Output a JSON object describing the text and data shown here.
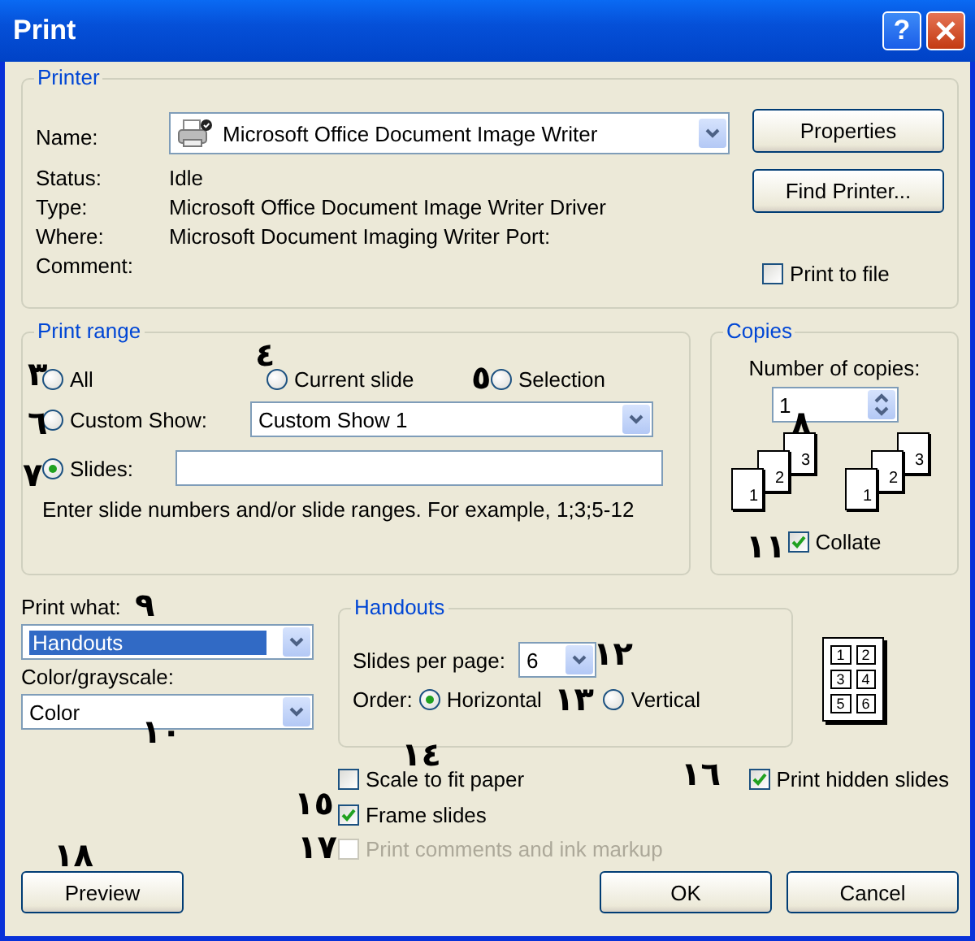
{
  "window": {
    "title": "Print",
    "help": "?"
  },
  "printer": {
    "title": "Printer",
    "name_label": "Name:",
    "name_value": "Microsoft Office Document Image Writer",
    "details": [
      {
        "label": "Status:",
        "value": "Idle"
      },
      {
        "label": "Type:",
        "value": "Microsoft Office Document Image Writer Driver"
      },
      {
        "label": "Where:",
        "value": "Microsoft Document Imaging Writer Port:"
      },
      {
        "label": "Comment:"
      }
    ],
    "properties_button": "Properties",
    "find_printer_button": "Find Printer...",
    "print_to_file": {
      "label": "Print to file",
      "checked": false
    }
  },
  "print_range": {
    "title": "Print range",
    "options": [
      {
        "label": "All",
        "selected": false
      },
      {
        "label": "Current slide",
        "selected": false
      },
      {
        "label": "Selection",
        "selected": false
      },
      {
        "label": "Custom Show:",
        "selected": false
      },
      {
        "label": "Slides:",
        "selected": true
      }
    ],
    "custom_show_value": "Custom Show 1",
    "hint": "Enter slide numbers and/or slide ranges. For example, 1;3;5-12"
  },
  "copies": {
    "title": "Copies",
    "label": "Number of copies:",
    "value": "1",
    "stacks": [
      [
        "1",
        "2",
        "3"
      ],
      [
        "1",
        "2",
        "3"
      ]
    ],
    "collate": {
      "label": "Collate",
      "checked": true
    }
  },
  "print_what": {
    "label": "Print what:",
    "value": "Handouts"
  },
  "color": {
    "label": "Color/grayscale:",
    "value": "Color"
  },
  "handouts": {
    "title": "Handouts",
    "per_page_label": "Slides per page:",
    "per_page_value": "6",
    "order_label": "Order:",
    "order": [
      {
        "label": "Horizontal",
        "selected": true
      },
      {
        "label": "Vertical",
        "selected": false
      }
    ],
    "preview": [
      "1",
      "2",
      "3",
      "4",
      "5",
      "6"
    ]
  },
  "options": [
    {
      "label": "Scale to fit paper",
      "checked": false,
      "disabled": false
    },
    {
      "label": "Print hidden slides",
      "checked": true,
      "disabled": false
    },
    {
      "label": "Frame slides",
      "checked": true,
      "disabled": false
    },
    {
      "label": "Print comments and ink markup",
      "checked": false,
      "disabled": true
    }
  ],
  "buttons": [
    "Preview",
    "OK",
    "Cancel"
  ],
  "annotations": [
    "٣",
    "٤",
    "٥",
    "٦",
    "٧",
    "٨",
    "١١",
    "٩",
    "١٠",
    "١٢",
    "١٣",
    "١٤",
    "١٥",
    "١٦",
    "١٧",
    "١٨"
  ]
}
